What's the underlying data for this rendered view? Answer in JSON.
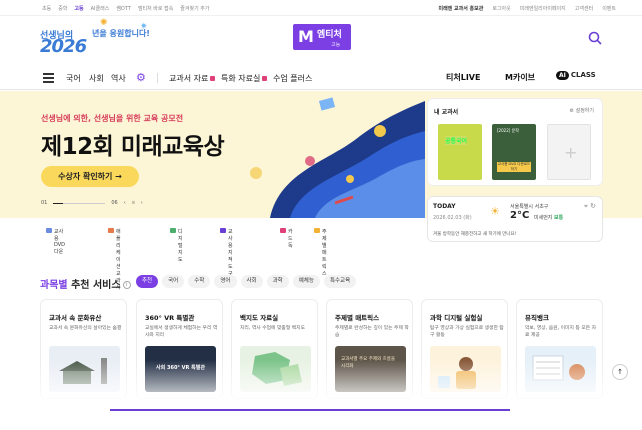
{
  "utility": {
    "left": [
      "초등",
      "중학",
      "고등",
      "AI클래스",
      "쌤OTT",
      "엠티처 바로 접속",
      "즐겨찾기 추가"
    ],
    "active": "고등",
    "right": [
      "미래엔 교과서 홍보관",
      "로그아웃",
      "미래엔일리아이페이지",
      "고객센터",
      "이벤트"
    ]
  },
  "header": {
    "promo_line1": "선생님의",
    "promo_year": "2026",
    "promo_line2": "년을 응원합니다!",
    "brand_name": "엠티처",
    "brand_level": "고등"
  },
  "nav": {
    "subjects": [
      "국어",
      "사회",
      "역사"
    ],
    "menus": [
      "교과서 자료",
      "특화 자료실",
      "수업 플러스"
    ],
    "right": [
      "티처LIVE",
      "M카이브",
      "CLASS"
    ],
    "ai_badge": "AI"
  },
  "banner": {
    "subtitle": "선생님에 의한, 선생님을 위한 교육 공모전",
    "title": "제12회 미래교육상",
    "cta": "수상자 확인하기 →",
    "pager_current": "01",
    "pager_total": "06"
  },
  "mybook": {
    "title": "내 교과서",
    "settings": "설정하기",
    "books": [
      {
        "title": "공통국어"
      },
      {
        "title": "[2022] 문학",
        "tag": "교사용 DVD 다운로드하기"
      }
    ],
    "add_label": "+"
  },
  "today": {
    "label": "TODAY",
    "date": "2026.02.03 (화)",
    "location": "서울특별시 서초구",
    "temperature": "2°C",
    "dust_label": "미세먼지",
    "dust_value": "보통",
    "message": "겨울 방학동안 재충전하고 새 학기에 만나요!"
  },
  "quick_links": [
    "교사용DVD다운",
    "애플리케이션교과서",
    "디지털 지도",
    "교사용 지적도구",
    "카드독",
    "주제별매트릭스"
  ],
  "subjects_section": {
    "title_accent": "과목별",
    "title_rest": " 추천 서비스",
    "chips": [
      "추천",
      "국어",
      "수학",
      "영어",
      "사회",
      "과학",
      "예체능",
      "특수교육"
    ],
    "active_chip": "추천",
    "cards": [
      {
        "title": "교과서 속 문화유산",
        "desc": "교과서 속 문화유산의 살아있는 숨결"
      },
      {
        "title": "360° VR 특별관",
        "desc": "교실에서 생생하게 체험하는 우리 역사와 지리",
        "img_text": "사회 360° VR 특별관"
      },
      {
        "title": "백지도 자료실",
        "desc": "지리, 역사 수업에 맞춤형 백지도"
      },
      {
        "title": "주제별 매트릭스",
        "desc": "주제별로 완성하는 깊이 있는 주제 학습",
        "img_text": "교과서별 주요 주제와 흐름을 시각화"
      },
      {
        "title": "과학 디지털 실험실",
        "desc": "탐구 영상과 가상 실험으로 생생한 탐구 활동"
      },
      {
        "title": "뮤직뱅크",
        "desc": "악보, 영상, 음원, 이미지 등 모든 자료 제공"
      }
    ]
  },
  "colors": {
    "brand": "#7b3fe4",
    "banner_bg": "#fdf6d6",
    "cta": "#f9d85c",
    "accent_red": "#d63d5b"
  }
}
